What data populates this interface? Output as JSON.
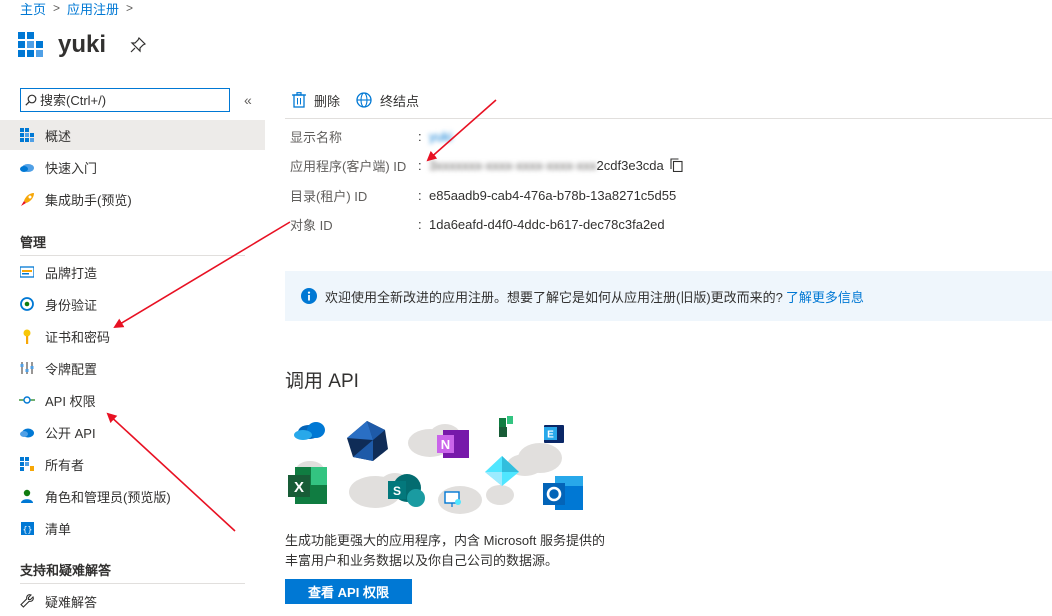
{
  "breadcrumb": {
    "home": "主页",
    "app_registrations": "应用注册"
  },
  "page": {
    "title": "yuki"
  },
  "search": {
    "placeholder": "搜索(Ctrl+/)"
  },
  "sidebar": {
    "collapse_glyph": "«",
    "top_items": [
      {
        "label": "概述",
        "icon": "overview-grid-icon",
        "active": true
      },
      {
        "label": "快速入门",
        "icon": "quickstart-cloud-icon"
      },
      {
        "label": "集成助手(预览)",
        "icon": "rocket-icon"
      }
    ],
    "manage_heading": "管理",
    "manage_items": [
      {
        "label": "品牌打造",
        "icon": "branding-icon"
      },
      {
        "label": "身份验证",
        "icon": "authentication-icon"
      },
      {
        "label": "证书和密码",
        "icon": "key-icon"
      },
      {
        "label": "令牌配置",
        "icon": "token-config-icon"
      },
      {
        "label": "API 权限",
        "icon": "api-permissions-icon"
      },
      {
        "label": "公开 API",
        "icon": "expose-api-cloud-icon"
      },
      {
        "label": "所有者",
        "icon": "owners-icon"
      },
      {
        "label": "角色和管理员(预览版)",
        "icon": "roles-admins-icon"
      },
      {
        "label": "清单",
        "icon": "manifest-icon"
      }
    ],
    "support_heading": "支持和疑难解答",
    "support_items": [
      {
        "label": "疑难解答",
        "icon": "wrench-icon"
      }
    ]
  },
  "toolbar": {
    "delete_label": "删除",
    "endpoints_label": "终结点"
  },
  "essentials": {
    "display_name_label": "显示名称",
    "display_name_value": "yuki",
    "app_id_label": "应用程序(客户端) ID",
    "app_id_value_hidden": "3xxxxxxx-xxxx-xxxx-xxxx-xxx",
    "app_id_value_visible": "2cdf3e3cda",
    "tenant_id_label": "目录(租户) ID",
    "tenant_id_value": "e85aadb9-cab4-476a-b78b-13a8271c5d55",
    "object_id_label": "对象 ID",
    "object_id_value": "1da6eafd-d4f0-4ddc-b617-dec78c3fa2ed",
    "colon": ":"
  },
  "banner": {
    "text": "欢迎使用全新改进的应用注册。想要了解它是如何从应用注册(旧版)更改而来的?",
    "link": "了解更多信息"
  },
  "api_section": {
    "title": "调用 API",
    "desc_line1": "生成功能更强大的应用程序，内含 Microsoft 服务提供的",
    "desc_line2": "丰富用户和业务数据以及你自己公司的数据源。",
    "button": "查看 API 权限"
  },
  "colors": {
    "accent": "#0078d4",
    "arrow": "#e81123"
  }
}
